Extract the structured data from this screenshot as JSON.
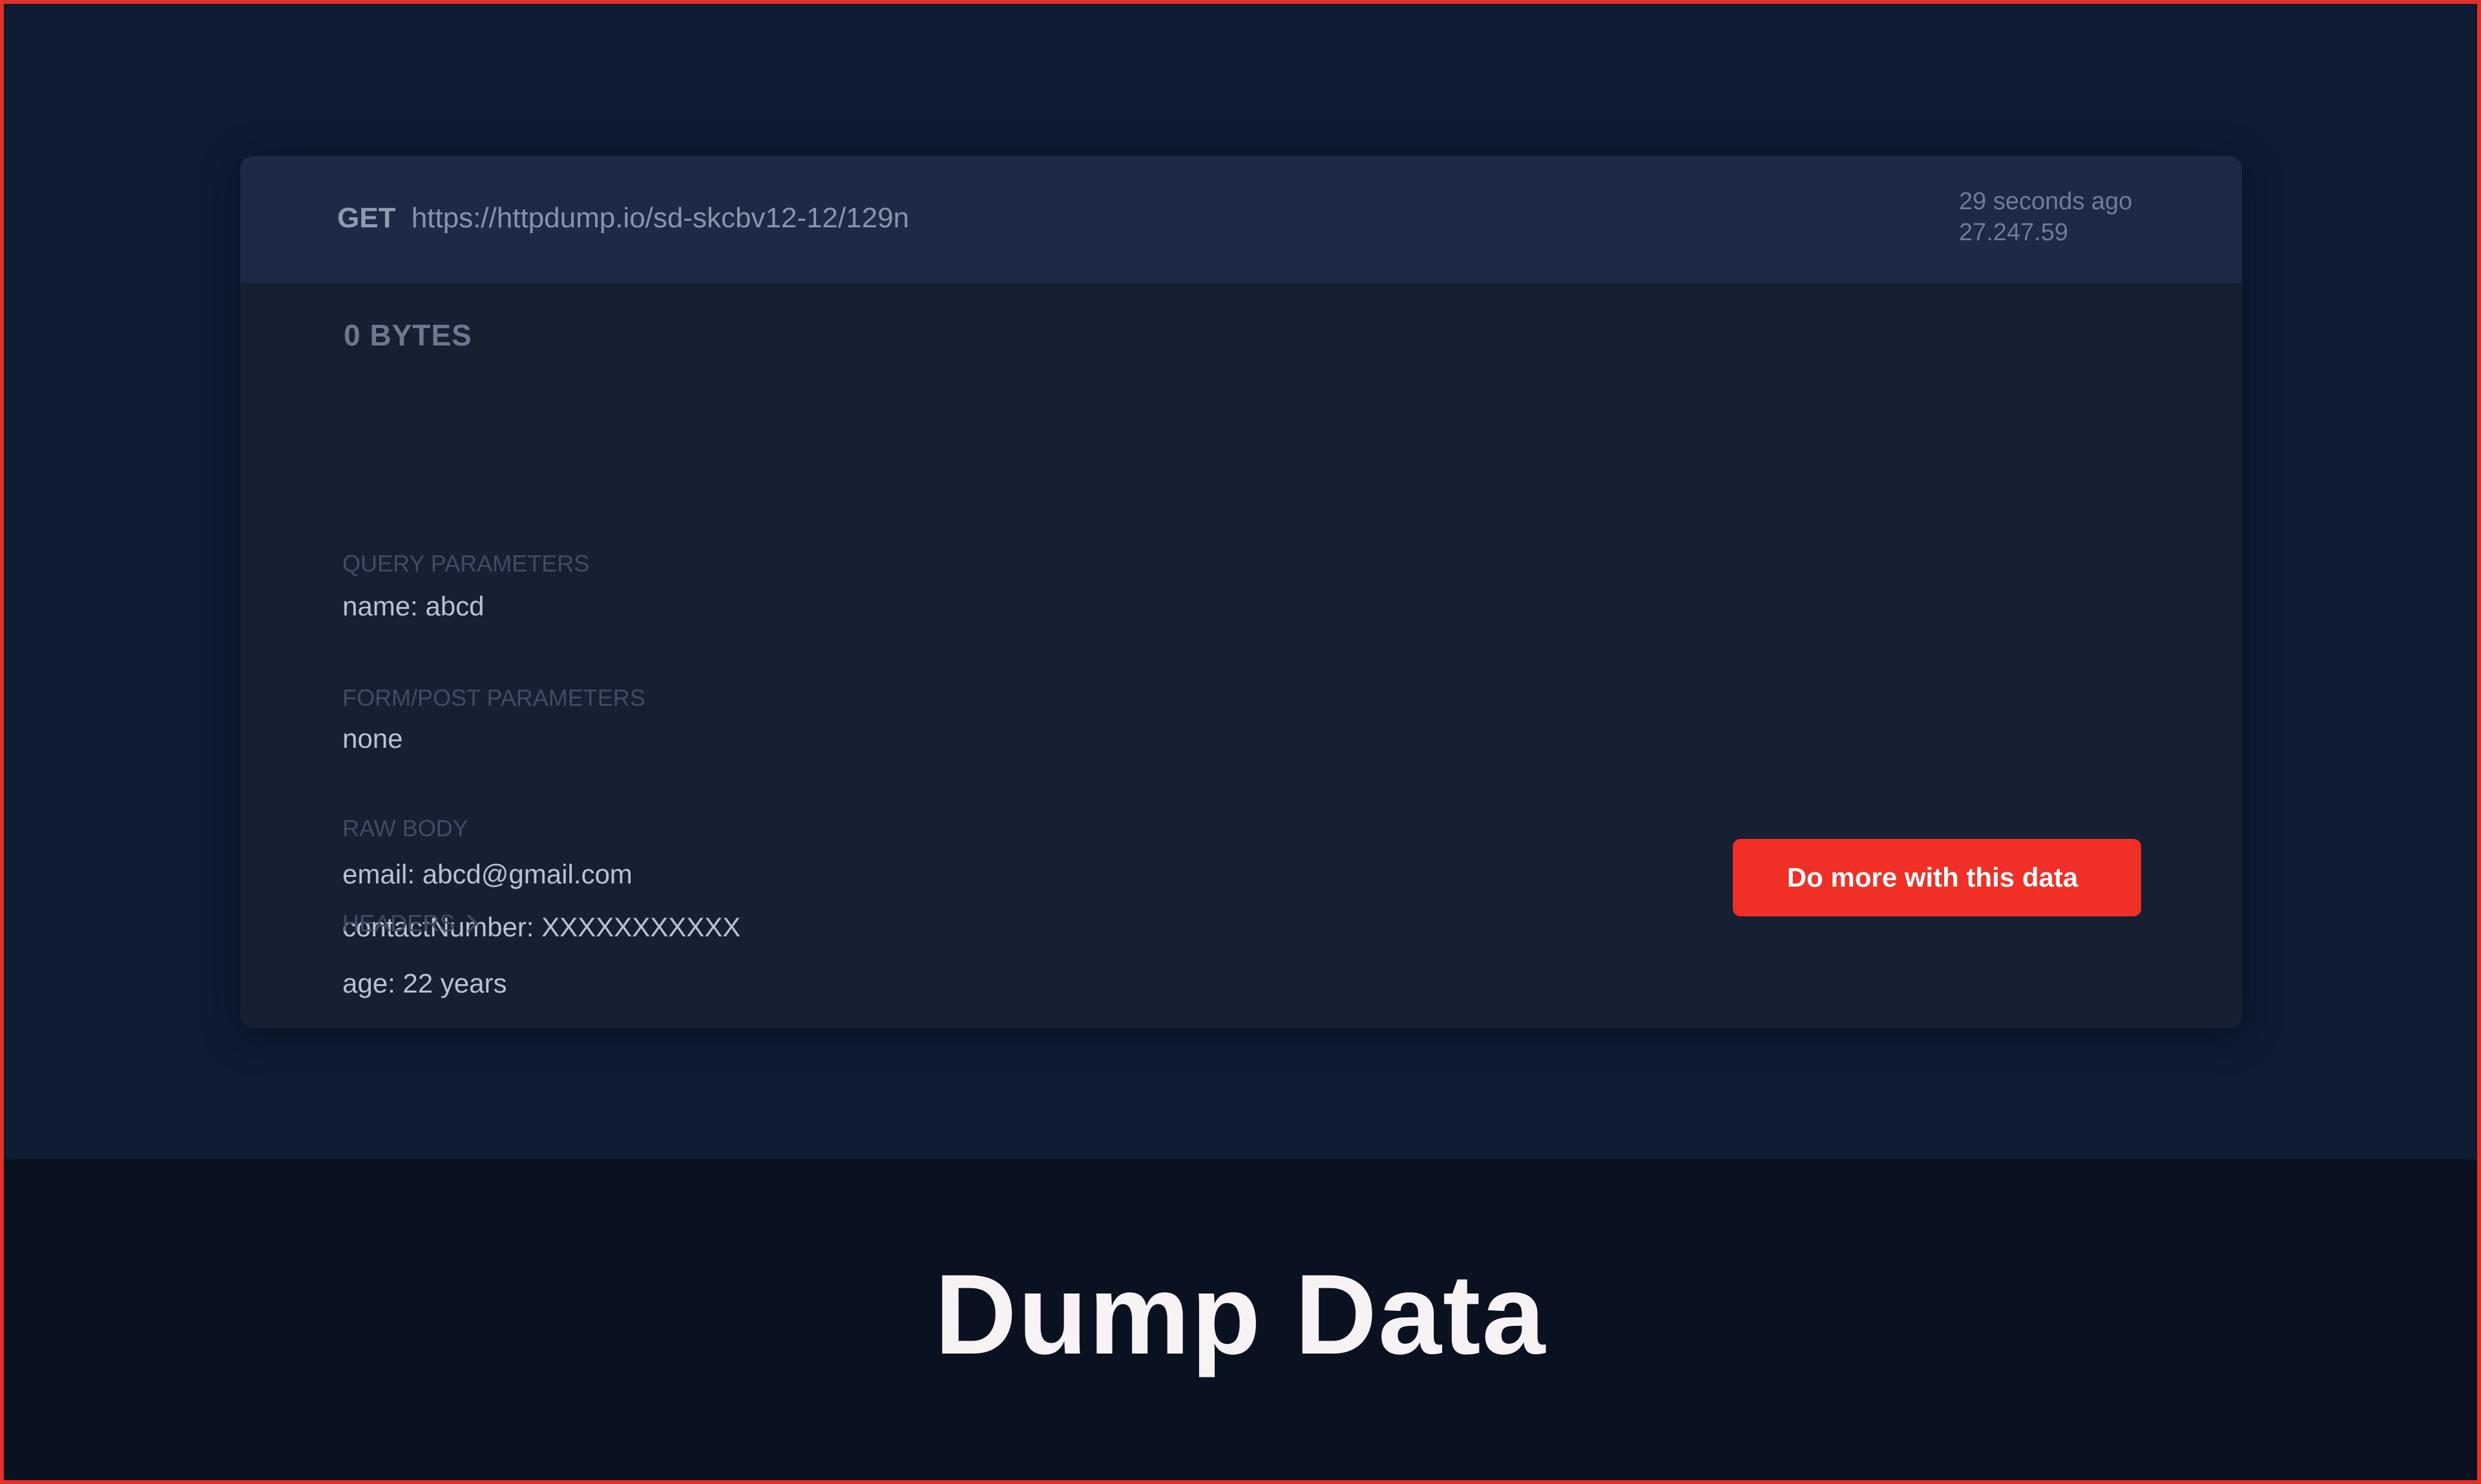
{
  "request": {
    "method": "GET",
    "url": "https://httpdump.io/sd-skcbv12-12/129n",
    "time_ago": "29 seconds ago",
    "ip": "27.247.59",
    "size": "0 BYTES"
  },
  "sections": {
    "query": {
      "label": "QUERY PARAMETERS",
      "value": "name: abcd"
    },
    "form": {
      "label": "FORM/POST PARAMETERS",
      "value": "none"
    },
    "raw_body": {
      "label": "RAW BODY",
      "lines": [
        "email: abcd@gmail.com",
        "contactNumber: XXXXXXXXXXX",
        "age: 22 years"
      ]
    },
    "headers": {
      "label": "HEADERS"
    }
  },
  "actions": {
    "cta_label": "Do more with this data"
  },
  "page": {
    "title": "Dump Data"
  },
  "colors": {
    "accent": "#f02f26",
    "background": "#0d1b33",
    "card": "#172033",
    "card_header": "#1c2a45",
    "footer": "#0a1120"
  },
  "icons": {
    "headers_toggle": "chevron-right-icon"
  }
}
